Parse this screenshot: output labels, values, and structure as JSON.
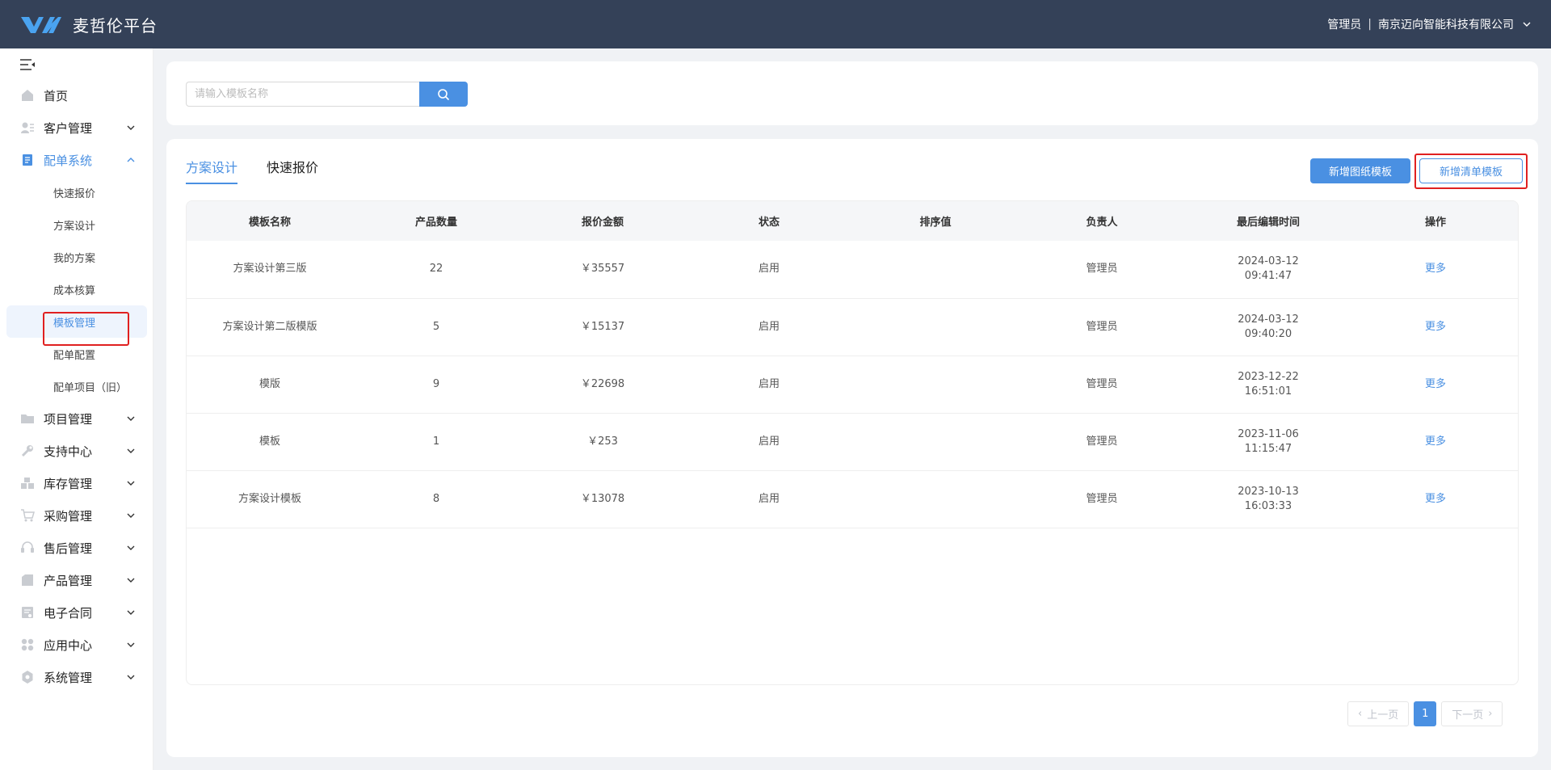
{
  "header": {
    "brand_title": "麦哲伦平台",
    "user_role": "管理员",
    "separator": "|",
    "company": "南京迈向智能科技有限公司"
  },
  "sidebar": {
    "items": [
      {
        "label": "首页",
        "icon": "home-icon"
      },
      {
        "label": "客户管理",
        "icon": "customer-icon"
      },
      {
        "label": "配单系统",
        "icon": "document-icon",
        "open": true,
        "children": [
          "快速报价",
          "方案设计",
          "我的方案",
          "成本核算",
          "模板管理",
          "配单配置",
          "配单项目（旧）"
        ],
        "active_child": "模板管理"
      },
      {
        "label": "项目管理",
        "icon": "folder-icon"
      },
      {
        "label": "支持中心",
        "icon": "wrench-icon"
      },
      {
        "label": "库存管理",
        "icon": "boxes-icon"
      },
      {
        "label": "采购管理",
        "icon": "cart-icon"
      },
      {
        "label": "售后管理",
        "icon": "headset-icon"
      },
      {
        "label": "产品管理",
        "icon": "product-icon"
      },
      {
        "label": "电子合同",
        "icon": "contract-icon"
      },
      {
        "label": "应用中心",
        "icon": "apps-icon"
      },
      {
        "label": "系统管理",
        "icon": "settings-icon"
      }
    ]
  },
  "search": {
    "placeholder": "请输入模板名称",
    "value": ""
  },
  "tabs": [
    {
      "label": "方案设计",
      "active": true
    },
    {
      "label": "快速报价",
      "active": false
    }
  ],
  "actions": {
    "add_drawing_template": "新增图纸模板",
    "add_list_template": "新增清单模板"
  },
  "table": {
    "columns": [
      "模板名称",
      "产品数量",
      "报价金额",
      "状态",
      "排序值",
      "负责人",
      "最后编辑时间",
      "操作"
    ],
    "rows": [
      {
        "name": "方案设计第三版",
        "count": "22",
        "amount": "￥35557",
        "status": "启用",
        "sort": "",
        "owner": "管理员",
        "date": "2024-03-12",
        "time": "09:41:47",
        "action": "更多"
      },
      {
        "name": "方案设计第二版模版",
        "count": "5",
        "amount": "￥15137",
        "status": "启用",
        "sort": "",
        "owner": "管理员",
        "date": "2024-03-12",
        "time": "09:40:20",
        "action": "更多"
      },
      {
        "name": "模版",
        "count": "9",
        "amount": "￥22698",
        "status": "启用",
        "sort": "",
        "owner": "管理员",
        "date": "2023-12-22",
        "time": "16:51:01",
        "action": "更多"
      },
      {
        "name": "模板",
        "count": "1",
        "amount": "￥253",
        "status": "启用",
        "sort": "",
        "owner": "管理员",
        "date": "2023-11-06",
        "time": "11:15:47",
        "action": "更多"
      },
      {
        "name": "方案设计模板",
        "count": "8",
        "amount": "￥13078",
        "status": "启用",
        "sort": "",
        "owner": "管理员",
        "date": "2023-10-13",
        "time": "16:03:33",
        "action": "更多"
      }
    ]
  },
  "pagination": {
    "prev": "上一页",
    "current": "1",
    "next": "下一页"
  },
  "colors": {
    "header_bg": "#344158",
    "accent": "#4a90e2",
    "highlight_box": "#e02020"
  }
}
